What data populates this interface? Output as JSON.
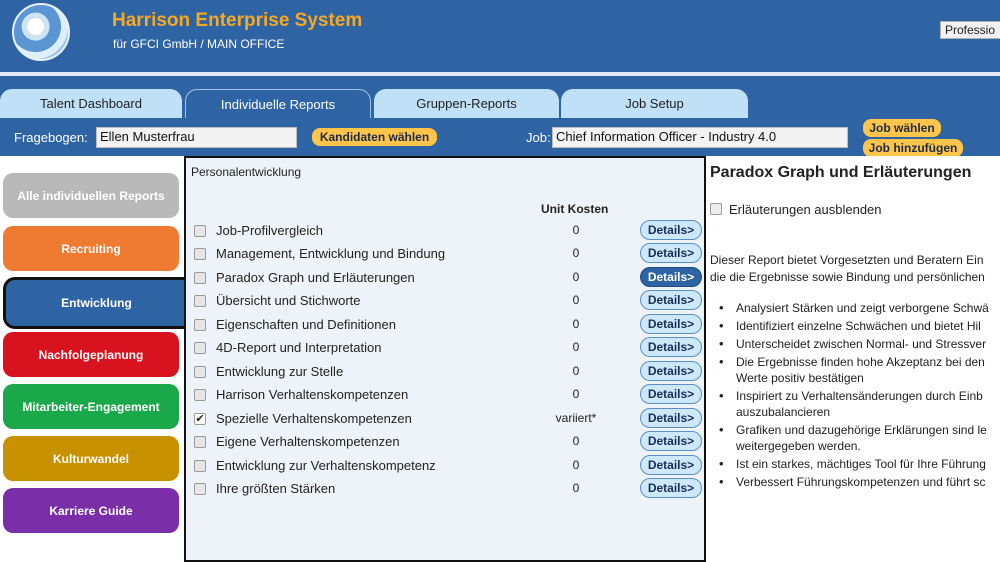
{
  "header": {
    "title": "Harrison Enterprise System",
    "subtitle": "für GFCI GmbH  / MAIN OFFICE",
    "edition_button": "Professio"
  },
  "tabs": [
    {
      "label": "Talent Dashboard",
      "active": false
    },
    {
      "label": "Individuelle Reports",
      "active": true
    },
    {
      "label": "Gruppen-Reports",
      "active": false
    },
    {
      "label": "Job Setup",
      "active": false
    }
  ],
  "filter": {
    "fragebogen_label": "Fragebogen:",
    "fragebogen_value": "Ellen Musterfrau",
    "kandidaten_button": "Kandidaten wählen",
    "job_label": "Job:",
    "job_value": "Chief Information Officer - Industry 4.0",
    "job_waehlen_button": "Job wählen",
    "job_hinzufuegen_button": "Job hinzufügen"
  },
  "sidebar": {
    "items": [
      {
        "label": "Alle individuellen Reports",
        "color": "#b9b9b9",
        "active": false
      },
      {
        "label": "Recruiting",
        "color": "#ef7b32",
        "active": false
      },
      {
        "label": "Entwicklung",
        "color": "#2f64a4",
        "active": true
      },
      {
        "label": "Nachfolgeplanung",
        "color": "#d9121f",
        "active": false
      },
      {
        "label": "Mitarbeiter-Engagement",
        "color": "#1aa84a",
        "active": false
      },
      {
        "label": "Kulturwandel",
        "color": "#c79100",
        "active": false
      },
      {
        "label": "Karriere Guide",
        "color": "#7a2fa8",
        "active": false
      }
    ]
  },
  "reports": {
    "section_title": "Personalentwicklung",
    "cost_header": "Unit Kosten",
    "details_label": "Details>",
    "rows": [
      {
        "label": "Job-Profilvergleich",
        "cost": "0",
        "checked": false,
        "active": false
      },
      {
        "label": "Management, Entwicklung und Bindung",
        "cost": "0",
        "checked": false,
        "active": false
      },
      {
        "label": "Paradox Graph und Erläuterungen",
        "cost": "0",
        "checked": false,
        "active": true
      },
      {
        "label": "Übersicht und Stichworte",
        "cost": "0",
        "checked": false,
        "active": false
      },
      {
        "label": "Eigenschaften und Definitionen",
        "cost": "0",
        "checked": false,
        "active": false
      },
      {
        "label": "4D-Report und Interpretation",
        "cost": "0",
        "checked": false,
        "active": false
      },
      {
        "label": "Entwicklung zur Stelle",
        "cost": "0",
        "checked": false,
        "active": false
      },
      {
        "label": "Harrison Verhaltenskompetenzen",
        "cost": "0",
        "checked": false,
        "active": false
      },
      {
        "label": "Spezielle Verhaltenskompetenzen",
        "cost": "variiert*",
        "checked": true,
        "active": false
      },
      {
        "label": "Eigene Verhaltenskompetenzen",
        "cost": "0",
        "checked": false,
        "active": false
      },
      {
        "label": "Entwicklung zur Verhaltenskompetenz",
        "cost": "0",
        "checked": false,
        "active": false
      },
      {
        "label": "Ihre größten Stärken",
        "cost": "0",
        "checked": false,
        "active": false
      }
    ]
  },
  "detail": {
    "title": "Paradox Graph und Erläuterungen",
    "hide_label": "Erläuterungen ausblenden",
    "intro_line1": "Dieser Report bietet Vorgesetzten und Beratern Ein",
    "intro_line2": "die die Ergebnisse sowie Bindung und persönlichen",
    "bullets": [
      {
        "l1": "Analysiert Stärken und zeigt verborgene Schwä",
        "l2": ""
      },
      {
        "l1": "Identifiziert einzelne Schwächen und bietet Hil",
        "l2": ""
      },
      {
        "l1": "Unterscheidet zwischen Normal- und Stressver",
        "l2": ""
      },
      {
        "l1": "Die Ergebnisse finden hohe Akzeptanz bei den",
        "l2": "Werte positiv bestätigen"
      },
      {
        "l1": "Inspiriert zu Verhaltensänderungen durch Einb",
        "l2": "auszubalancieren"
      },
      {
        "l1": "Grafiken und dazugehörige Erklärungen sind le",
        "l2": "weitergegeben werden."
      },
      {
        "l1": "Ist ein starkes, mächtiges Tool für Ihre Führung",
        "l2": ""
      },
      {
        "l1": "Verbessert Führungskompetenzen und führt sc",
        "l2": ""
      }
    ]
  }
}
